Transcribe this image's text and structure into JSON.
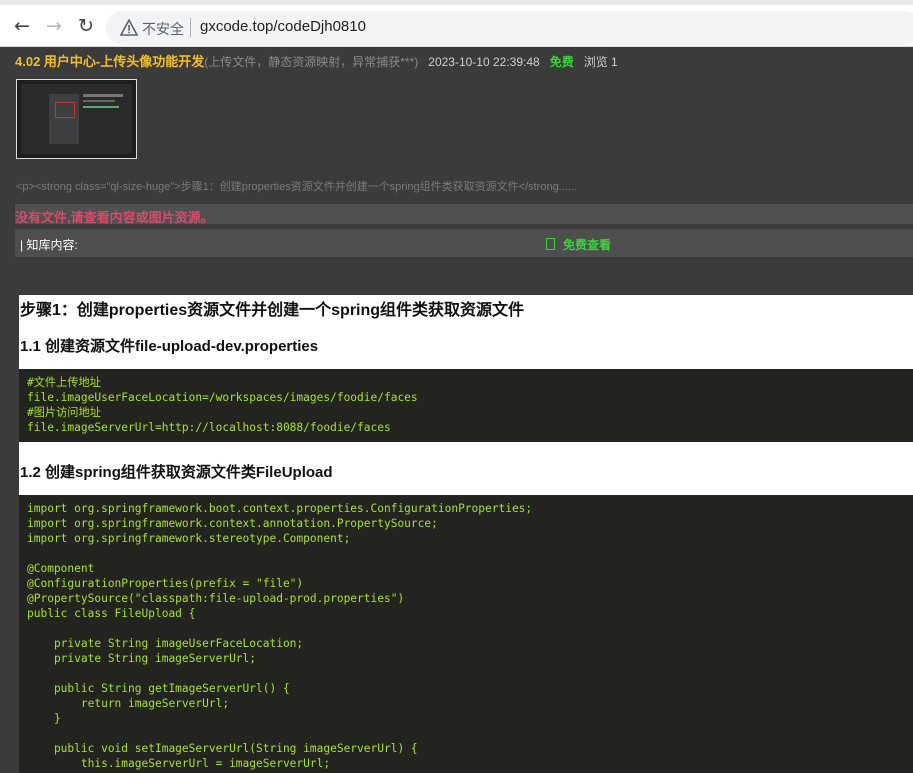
{
  "browser": {
    "back_icon": "back-arrow-icon",
    "forward_icon": "forward-arrow-icon",
    "reload_icon": "reload-icon",
    "security_label": "不安全",
    "url": "gxcode.top/codeDjh0810"
  },
  "article": {
    "title": "4.02 用户中心-上传头像功能开发",
    "subtitle": "(上传文件，静态资源映射，异常捕获***)",
    "date": "2023-10-10 22:39:48",
    "price": "免费",
    "views": "浏览 1",
    "excerpt": "<p><strong class=\"ql-size-huge\">步骤1：创建properties资源文件并创建一个spring组件类获取资源文件</strong......",
    "no_file_notice": "没有文件,请查看内容或图片资源。",
    "kb_label": "| 知库内容:",
    "free_view": "免费查看"
  },
  "content": {
    "step_heading": "步骤1：创建properties资源文件并创建一个spring组件类获取资源文件",
    "sub_heading_1": "1.1 创建资源文件file-upload-dev.properties",
    "code_block_1": [
      "#文件上传地址",
      "file.imageUserFaceLocation=/workspaces/images/foodie/faces",
      "#图片访问地址",
      "file.imageServerUrl=http://localhost:8088/foodie/faces"
    ],
    "sub_heading_2": "1.2 创建spring组件获取资源文件类FileUpload",
    "code_block_2": [
      "import org.springframework.boot.context.properties.ConfigurationProperties;",
      "import org.springframework.context.annotation.PropertySource;",
      "import org.springframework.stereotype.Component;",
      "",
      "@Component",
      "@ConfigurationProperties(prefix = \"file\")",
      "@PropertySource(\"classpath:file-upload-prod.properties\")",
      "public class FileUpload {",
      "",
      "    private String imageUserFaceLocation;",
      "    private String imageServerUrl;",
      "",
      "    public String getImageServerUrl() {",
      "        return imageServerUrl;",
      "    }",
      "",
      "    public void setImageServerUrl(String imageServerUrl) {",
      "        this.imageServerUrl = imageServerUrl;"
    ]
  }
}
